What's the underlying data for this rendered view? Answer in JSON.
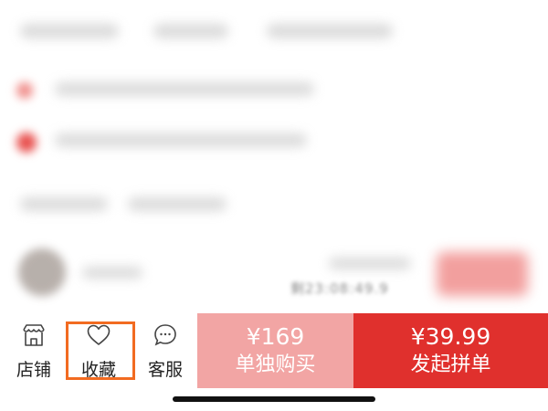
{
  "background": {
    "countdown_text": "剩23:08:49.9"
  },
  "bottom_bar": {
    "store": {
      "label": "店铺",
      "icon": "store-icon"
    },
    "favorite": {
      "label": "收藏",
      "icon": "heart-icon",
      "highlight_color": "#f26b21"
    },
    "customer_service": {
      "label": "客服",
      "icon": "chat-icon"
    },
    "buy_solo": {
      "price": "¥169",
      "label": "单独购买",
      "color": "#f2a5a4"
    },
    "buy_group": {
      "price": "¥39.99",
      "label": "发起拼单",
      "color": "#e0302d"
    }
  }
}
